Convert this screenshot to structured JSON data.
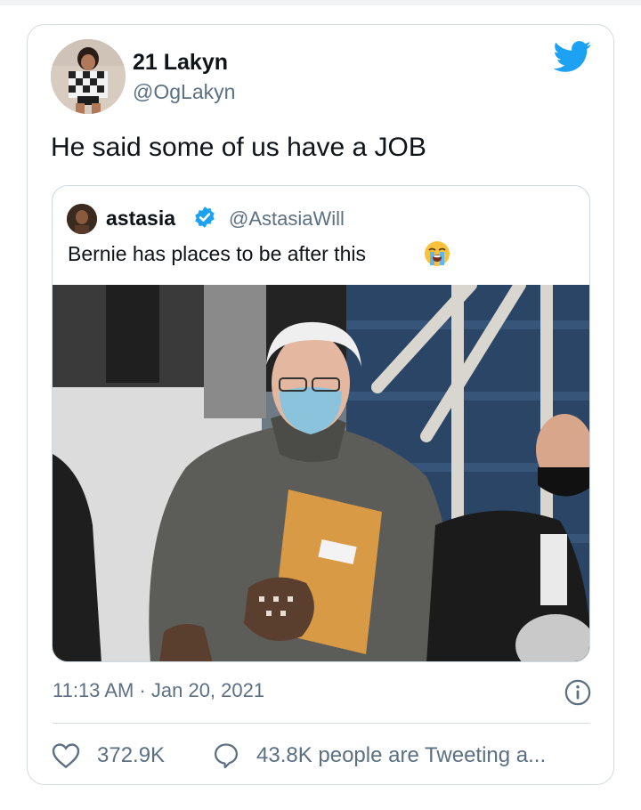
{
  "tweet": {
    "author_name": "21 Lakyn",
    "author_handle": "@OgLakyn",
    "text": "He said some of us have a JOB",
    "timestamp": "11:13 AM · Jan 20, 2021",
    "likes": "372.9K",
    "conversation": "43.8K people are Tweeting a..."
  },
  "quoted_tweet": {
    "author_name": "astasia",
    "author_handle": "@AstasiaWill",
    "text": "Bernie has places to be after this",
    "emoji": "loudly-crying-face-icon"
  },
  "colors": {
    "twitter_blue": "#1da1f2",
    "secondary_text": "#5b7083",
    "border": "#d5dadd"
  },
  "icons": [
    "twitter-bird-icon",
    "verified-badge-icon",
    "info-icon",
    "heart-icon",
    "reply-bubble-icon"
  ]
}
